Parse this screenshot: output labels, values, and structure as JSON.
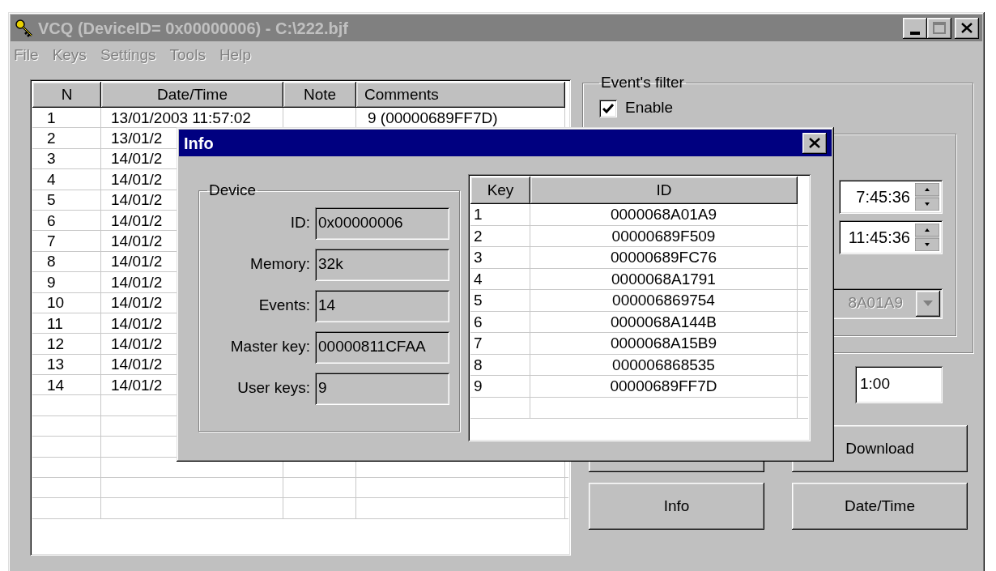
{
  "window": {
    "title": "VCQ (DeviceID= 0x00000006) - C:\\222.bjf",
    "active": false
  },
  "menu": [
    {
      "label": "File",
      "disabled": true
    },
    {
      "label": "Keys",
      "disabled": true
    },
    {
      "label": "Settings",
      "disabled": true
    },
    {
      "label": "Tools",
      "disabled": true
    },
    {
      "label": "Help",
      "disabled": true
    }
  ],
  "events_table": {
    "columns": [
      "N",
      "Date/Time",
      "Note",
      "Comments"
    ],
    "rows": [
      {
        "n": "1",
        "date_time": "13/01/2003 11:57:02",
        "comments": "9 (00000689FF7D)"
      },
      {
        "n": "2",
        "date_time": "13/01/2"
      },
      {
        "n": "3",
        "date_time": "14/01/2"
      },
      {
        "n": "4",
        "date_time": "14/01/2"
      },
      {
        "n": "5",
        "date_time": "14/01/2"
      },
      {
        "n": "6",
        "date_time": "14/01/2"
      },
      {
        "n": "7",
        "date_time": "14/01/2"
      },
      {
        "n": "8",
        "date_time": "14/01/2"
      },
      {
        "n": "9",
        "date_time": "14/01/2"
      },
      {
        "n": "10",
        "date_time": "14/01/2"
      },
      {
        "n": "11",
        "date_time": "14/01/2"
      },
      {
        "n": "12",
        "date_time": "14/01/2"
      },
      {
        "n": "13",
        "date_time": "14/01/2"
      },
      {
        "n": "14",
        "date_time": "14/01/2"
      }
    ]
  },
  "filter": {
    "title": "Event's filter",
    "enable": {
      "label": "Enable",
      "checked": true
    },
    "from_time": "7:45:36",
    "to_time": "11:45:36",
    "key_combo": {
      "value": "8A01A9",
      "disabled": true
    },
    "duration": "1:00"
  },
  "buttons": [
    {
      "kind": "covered"
    },
    {
      "kind": "push",
      "label": "Download"
    },
    {
      "kind": "push",
      "label": "Info"
    },
    {
      "kind": "push",
      "label": "Date/Time"
    }
  ],
  "info_dialog": {
    "title": "Info",
    "active": true,
    "device": {
      "title": "Device",
      "fields": [
        {
          "label": "ID:",
          "value": "0x00000006"
        },
        {
          "label": "Memory:",
          "value": "32k"
        },
        {
          "label": "Events:",
          "value": "14"
        },
        {
          "label": "Master key:",
          "value": "00000811CFAA"
        },
        {
          "label": "User keys:",
          "value": "9"
        }
      ]
    },
    "keys_table": {
      "columns": [
        "Key",
        "ID"
      ],
      "rows": [
        [
          "1",
          "0000068A01A9"
        ],
        [
          "2",
          "00000689F509"
        ],
        [
          "3",
          "00000689FC76"
        ],
        [
          "4",
          "0000068A1791"
        ],
        [
          "5",
          "000006869754"
        ],
        [
          "6",
          "0000068A144B"
        ],
        [
          "7",
          "0000068A15B9"
        ],
        [
          "8",
          "000006868535"
        ],
        [
          "9",
          "00000689FF7D"
        ]
      ]
    }
  }
}
